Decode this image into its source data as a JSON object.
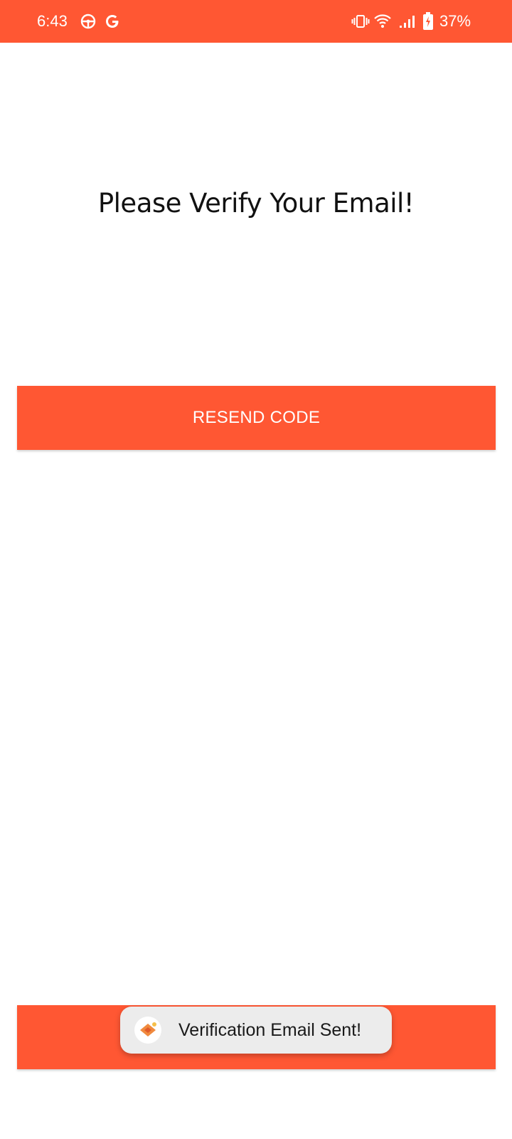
{
  "status_bar": {
    "time": "6:43",
    "battery": "37%",
    "icons": [
      "steering-wheel-icon",
      "google-g-icon",
      "vibrate-icon",
      "wifi-icon",
      "signal-icon",
      "battery-charging-icon"
    ],
    "background_color": "#FF5733"
  },
  "main": {
    "title": "Please Verify Your Email!",
    "resend_label": "RESEND CODE",
    "bottom_button_label": ""
  },
  "toast": {
    "message": "Verification Email Sent!",
    "icon": "app-icon"
  },
  "colors": {
    "accent": "#FF5733",
    "background": "#FFFFFF",
    "toast_background": "#ECECEC"
  }
}
